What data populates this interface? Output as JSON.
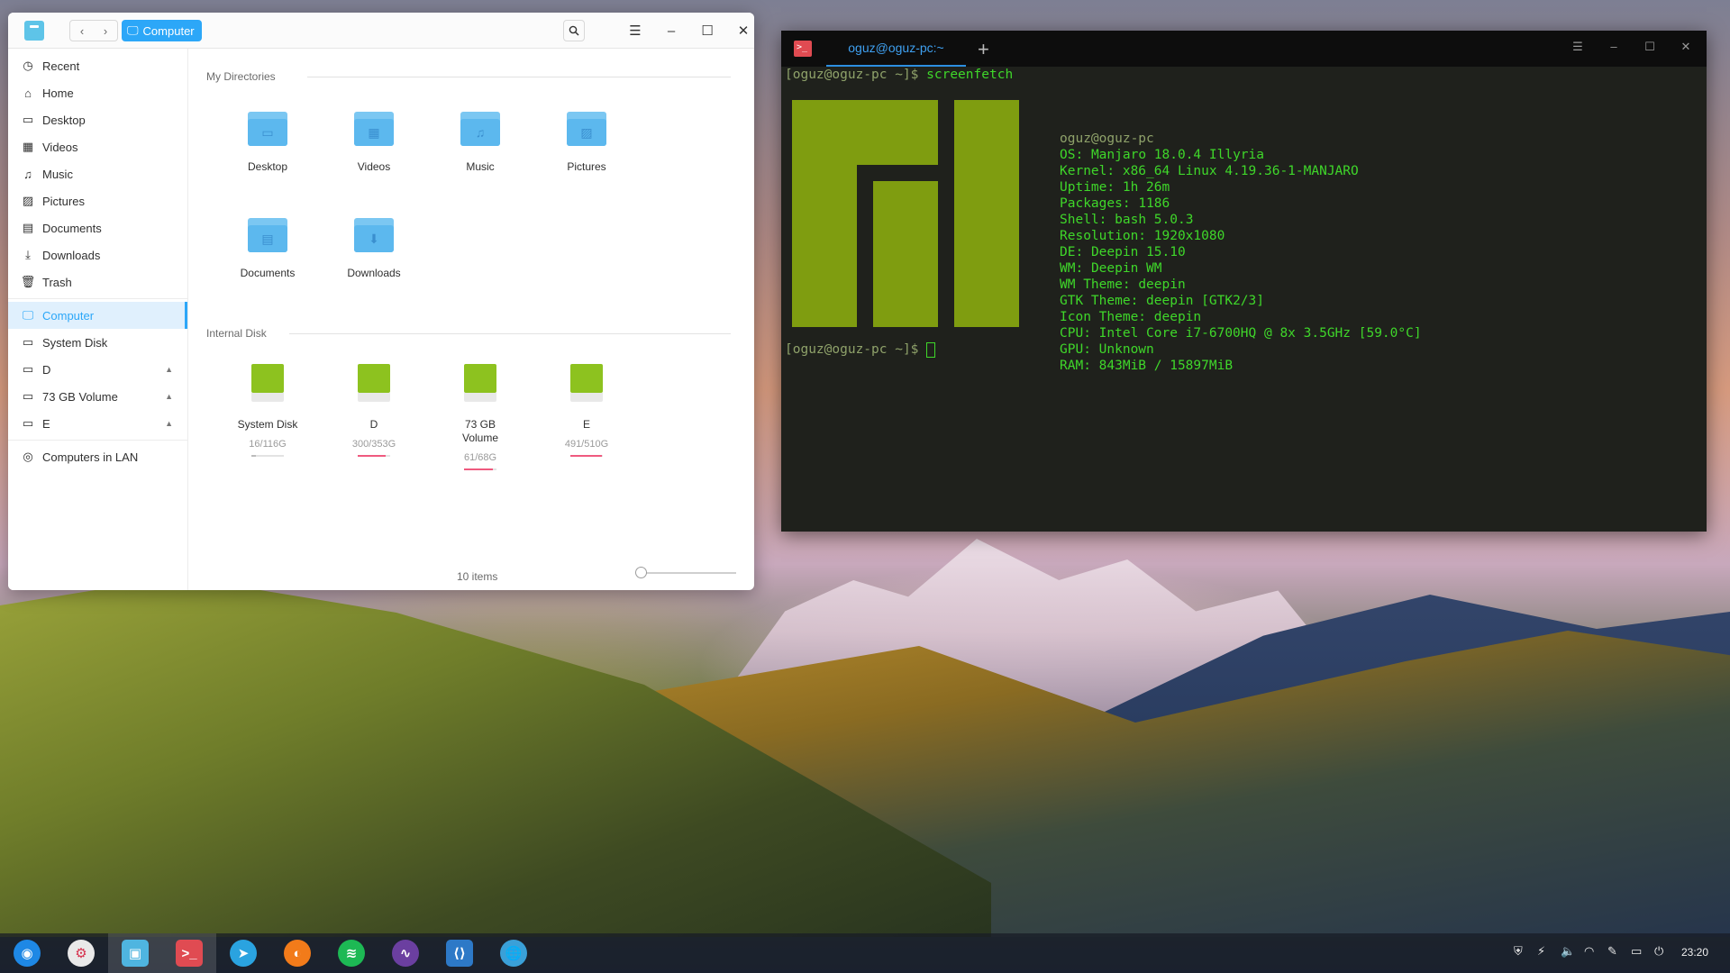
{
  "file_manager": {
    "breadcrumb": "Computer",
    "sidebar": [
      {
        "label": "Recent",
        "icon": "clock-icon",
        "glyph": "◷"
      },
      {
        "label": "Home",
        "icon": "home-icon",
        "glyph": "⌂"
      },
      {
        "label": "Desktop",
        "icon": "desktop-icon",
        "glyph": "▭"
      },
      {
        "label": "Videos",
        "icon": "video-icon",
        "glyph": "▦"
      },
      {
        "label": "Music",
        "icon": "music-icon",
        "glyph": "♫"
      },
      {
        "label": "Pictures",
        "icon": "picture-icon",
        "glyph": "▨"
      },
      {
        "label": "Documents",
        "icon": "document-icon",
        "glyph": "▤"
      },
      {
        "label": "Downloads",
        "icon": "download-icon",
        "glyph": "⤓"
      },
      {
        "label": "Trash",
        "icon": "trash-icon",
        "glyph": "🗑"
      },
      {
        "label": "Computer",
        "icon": "computer-icon",
        "glyph": "🖵"
      },
      {
        "label": "System Disk",
        "icon": "disk-icon",
        "glyph": "▭"
      },
      {
        "label": "D",
        "icon": "disk-icon",
        "glyph": "▭"
      },
      {
        "label": "73 GB Volume",
        "icon": "disk-icon",
        "glyph": "▭"
      },
      {
        "label": "E",
        "icon": "disk-icon",
        "glyph": "▭"
      },
      {
        "label": "Computers in LAN",
        "icon": "network-icon",
        "glyph": "◎"
      }
    ],
    "my_directories_title": "My Directories",
    "directories": [
      {
        "label": "Desktop",
        "glyph": "▭"
      },
      {
        "label": "Videos",
        "glyph": "▦"
      },
      {
        "label": "Music",
        "glyph": "♫"
      },
      {
        "label": "Pictures",
        "glyph": "▨"
      },
      {
        "label": "Documents",
        "glyph": "▤"
      },
      {
        "label": "Downloads",
        "glyph": "⬇"
      }
    ],
    "internal_disk_title": "Internal Disk",
    "disks": [
      {
        "label": "System Disk",
        "usage": "16/116G",
        "fraction": 0.14,
        "color": "#bcbcbc"
      },
      {
        "label": "D",
        "usage": "300/353G",
        "fraction": 0.85,
        "color": "#ef5a7f"
      },
      {
        "label": "73 GB Volume",
        "usage": "61/68G",
        "fraction": 0.9,
        "color": "#ef5a7f"
      },
      {
        "label": "E",
        "usage": "491/510G",
        "fraction": 0.96,
        "color": "#ef5a7f"
      }
    ],
    "status": "10 items",
    "accent": "#2ca7f8"
  },
  "terminal": {
    "tab": "oguz@oguz-pc:~",
    "prompt": "[oguz@oguz-pc ~]$",
    "command": "screenfetch",
    "info": [
      {
        "key": "",
        "value": "oguz@oguz-pc"
      },
      {
        "key": "OS:",
        "value": "Manjaro 18.0.4 Illyria"
      },
      {
        "key": "Kernel:",
        "value": "x86_64 Linux 4.19.36-1-MANJARO"
      },
      {
        "key": "Uptime:",
        "value": "1h 26m"
      },
      {
        "key": "Packages:",
        "value": "1186"
      },
      {
        "key": "Shell:",
        "value": "bash 5.0.3"
      },
      {
        "key": "Resolution:",
        "value": "1920x1080"
      },
      {
        "key": "DE:",
        "value": "Deepin 15.10"
      },
      {
        "key": "WM:",
        "value": "Deepin WM"
      },
      {
        "key": "WM Theme:",
        "value": "deepin"
      },
      {
        "key": "GTK Theme:",
        "value": "deepin [GTK2/3]"
      },
      {
        "key": "Icon Theme:",
        "value": "deepin"
      },
      {
        "key": "CPU:",
        "value": "Intel Core i7-6700HQ @ 8x 3.5GHz [59.0°C]"
      },
      {
        "key": "GPU:",
        "value": "Unknown"
      },
      {
        "key": "RAM:",
        "value": "843MiB / 15897MiB"
      }
    ],
    "text_color": "#3fd72a",
    "logo_color": "#7f9d10"
  },
  "dock": {
    "apps": [
      {
        "name": "launcher-icon",
        "bg": "#1e88e5",
        "glyph": "◉"
      },
      {
        "name": "settings-icon",
        "bg": "#e9e9e9",
        "glyph": "⚙"
      },
      {
        "name": "file-manager-icon",
        "bg": "#4fb5e0",
        "glyph": "▣"
      },
      {
        "name": "terminal-icon",
        "bg": "#e04b52",
        "glyph": ">_"
      },
      {
        "name": "telegram-icon",
        "bg": "#2aa3e0",
        "glyph": "➤"
      },
      {
        "name": "firefox-icon",
        "bg": "#f27b1a",
        "glyph": "◐"
      },
      {
        "name": "spotify-icon",
        "bg": "#1db954",
        "glyph": "≋"
      },
      {
        "name": "system-monitor-icon",
        "bg": "#6b3fa0",
        "glyph": "∿"
      },
      {
        "name": "vscode-icon",
        "bg": "#2d79c7",
        "glyph": "⟨⟩"
      },
      {
        "name": "browser-globe-icon",
        "bg": "#3aa0d8",
        "glyph": "🌐"
      }
    ],
    "tray": [
      "shield-icon",
      "usb-icon",
      "volume-icon",
      "wifi-icon",
      "pen-icon",
      "battery-icon",
      "power-icon"
    ],
    "clock": "23:20"
  }
}
